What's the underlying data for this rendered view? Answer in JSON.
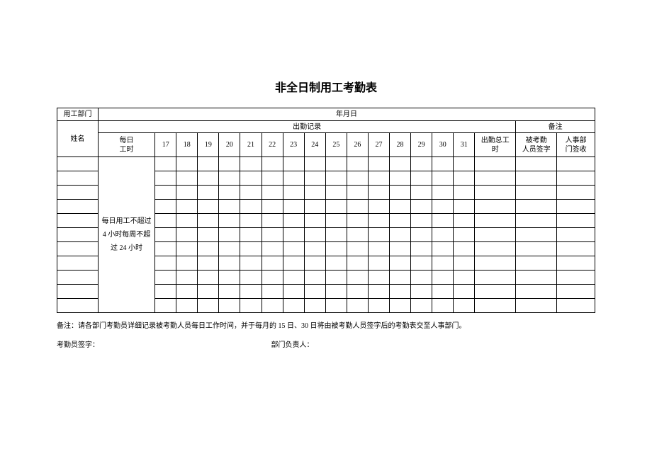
{
  "title": "非全日制用工考勤表",
  "header": {
    "dept_label": "用工部门",
    "date_label": "年月日",
    "name_label": "姓名",
    "attendance_section": "出勤记录",
    "remarks_section": "备注",
    "daily_hours_label": "每日\n工时",
    "days": [
      "17",
      "18",
      "19",
      "20",
      "21",
      "22",
      "23",
      "24",
      "25",
      "26",
      "27",
      "28",
      "29",
      "30",
      "31"
    ],
    "total_hours_label": "出勤总工\n时",
    "signee_label": "被考勤\n人员签字",
    "hr_label": "人事部\n门签收"
  },
  "side_note": "每日用工不超过 4 小时每周不超过 24 小时",
  "footer": {
    "note": "备注：请各部门考勤员详细记录被考勤人员每日工作时间，并于每月的 15 日、30 日将由被考勤人员签字后的考勤表交至人事部门。",
    "signer_label": "考勤员签字：",
    "manager_label": "部门负责人："
  },
  "data_row_count": 11
}
